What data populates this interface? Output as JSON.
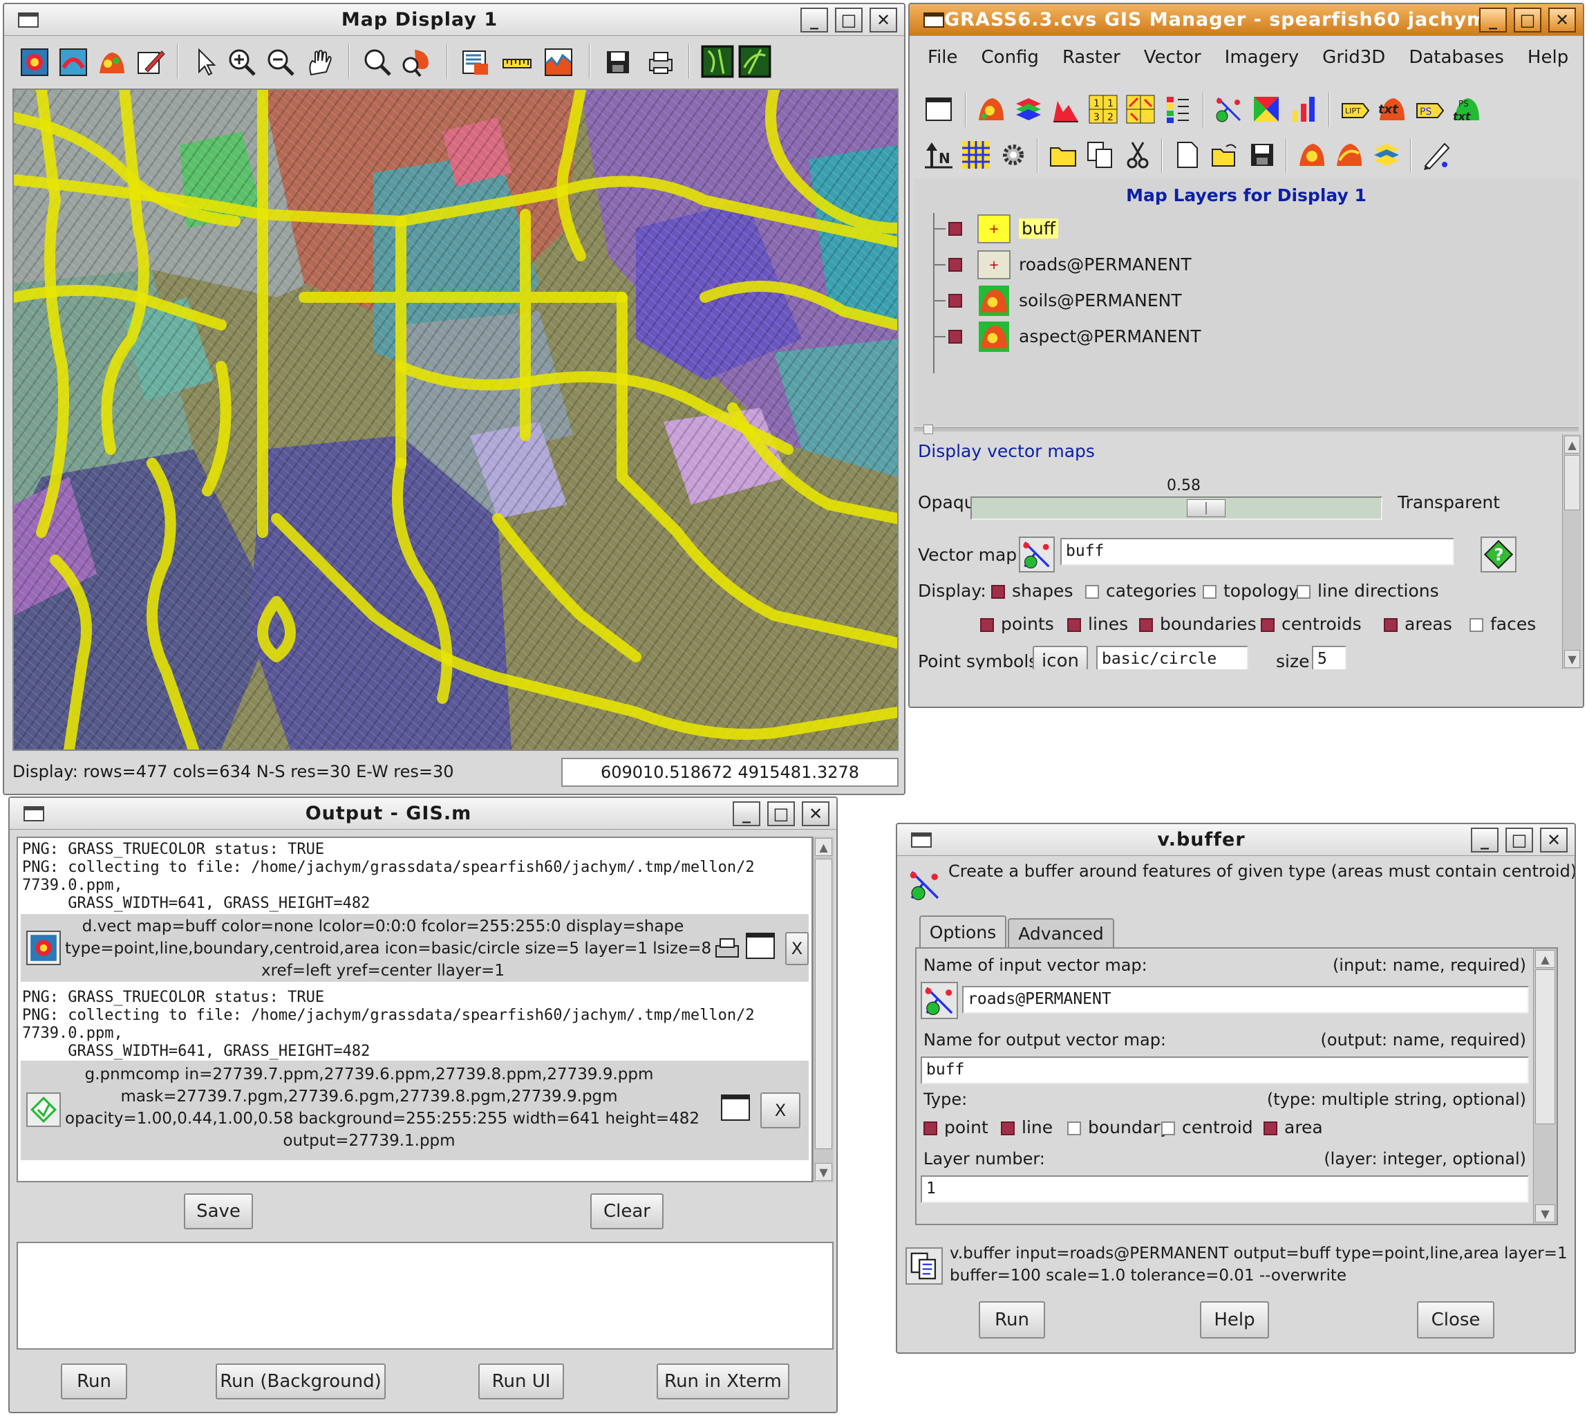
{
  "map_display": {
    "title": "Map Display 1",
    "status_left": "Display: rows=477 cols=634 N-S res=30 E-W res=30",
    "status_right": "609010.518672 4915481.3278",
    "toolbar_icons": [
      "display-map-icon",
      "redraw-icon",
      "add-overlay-icon",
      "erase-icon",
      "pointer-icon",
      "zoom-in-icon",
      "zoom-out-icon",
      "pan-icon",
      "zoom-extent-icon",
      "zoom-region-icon",
      "query-icon",
      "measure-icon",
      "profile-icon",
      "save-display-icon",
      "print-icon",
      "nviz-icon",
      "georectify-icon"
    ]
  },
  "gis_manager": {
    "title": "GRASS6.3.cvs GIS Manager - spearfish60 jachym",
    "menu": [
      "File",
      "Config",
      "Raster",
      "Vector",
      "Imagery",
      "Grid3D",
      "Databases",
      "Help"
    ],
    "layers_header": "Map Layers for Display 1",
    "layers": [
      {
        "name": "buff",
        "icon": "vector-layer-icon",
        "highlight": true
      },
      {
        "name": "roads@PERMANENT",
        "icon": "vector-layer-icon",
        "highlight": false
      },
      {
        "name": "soils@PERMANENT",
        "icon": "raster-layer-icon",
        "highlight": false
      },
      {
        "name": "aspect@PERMANENT",
        "icon": "raster-layer-icon",
        "highlight": false
      }
    ],
    "panel": {
      "heading": "Display vector maps",
      "opacity_value": "0.58",
      "opacity_fraction": 0.58,
      "opaque_label": "Opaque",
      "transparent_label": "Transparent",
      "vector_map_label": "Vector map:",
      "vector_map_value": "buff",
      "display_label": "Display:",
      "display_options": [
        {
          "label": "shapes",
          "checked": true
        },
        {
          "label": "categories",
          "checked": false
        },
        {
          "label": "topology",
          "checked": false
        },
        {
          "label": "line directions",
          "checked": false
        }
      ],
      "type_options": [
        {
          "label": "points",
          "checked": true
        },
        {
          "label": "lines",
          "checked": true
        },
        {
          "label": "boundaries",
          "checked": true
        },
        {
          "label": "centroids",
          "checked": true
        },
        {
          "label": "areas",
          "checked": true
        },
        {
          "label": "faces",
          "checked": false
        }
      ],
      "point_symbols_label": "Point symbols:",
      "icon_button": "icon",
      "symbol_value": "basic/circle",
      "size_label": "size",
      "size_value": "5"
    }
  },
  "output": {
    "title": "Output - GIS.m",
    "log1": [
      "PNG: GRASS_TRUECOLOR status: TRUE",
      "PNG: collecting to file: /home/jachym/grassdata/spearfish60/jachym/.tmp/mellon/2",
      "7739.0.ppm,",
      "     GRASS_WIDTH=641, GRASS_HEIGHT=482"
    ],
    "cmd1": [
      "d.vect map=buff color=none lcolor=0:0:0 fcolor=255:255:0 display=shape",
      "type=point,line,boundary,centroid,area icon=basic/circle size=5 layer=1 lsize=8",
      "xref=left yref=center llayer=1"
    ],
    "log2": [
      "PNG: GRASS_TRUECOLOR status: TRUE",
      "PNG: collecting to file: /home/jachym/grassdata/spearfish60/jachym/.tmp/mellon/2",
      "7739.0.ppm,",
      "     GRASS_WIDTH=641, GRASS_HEIGHT=482"
    ],
    "cmd2": [
      "g.pnmcomp in=27739.7.ppm,27739.6.ppm,27739.8.ppm,27739.9.ppm",
      "mask=27739.7.pgm,27739.6.pgm,27739.8.pgm,27739.9.pgm",
      "opacity=1.00,0.44,1.00,0.58 background=255:255:255 width=641 height=482",
      "output=27739.1.ppm"
    ],
    "close_label": "X",
    "save": "Save",
    "clear": "Clear",
    "run": "Run",
    "run_background": "Run (Background)",
    "run_ui": "Run UI",
    "run_xterm": "Run in Xterm"
  },
  "vbuffer": {
    "title": "v.buffer",
    "description": "Create a buffer around features of given type (areas must contain centroid).",
    "tabs": [
      "Options",
      "Advanced"
    ],
    "input_label": "Name of input vector map:",
    "input_hint": "(input:  name, required)",
    "input_value": "roads@PERMANENT",
    "output_label": "Name for output vector map:",
    "output_hint": "(output:  name, required)",
    "output_value": "buff",
    "type_label": "Type:",
    "type_hint": "(type: multiple string, optional)",
    "types": [
      {
        "label": "point",
        "checked": true
      },
      {
        "label": "line",
        "checked": true
      },
      {
        "label": "boundary",
        "checked": false
      },
      {
        "label": "centroid",
        "checked": false
      },
      {
        "label": "area",
        "checked": true
      }
    ],
    "layer_label": "Layer number:",
    "layer_hint": "(layer:  integer, optional)",
    "layer_value": "1",
    "command": [
      "v.buffer input=roads@PERMANENT output=buff type=point,line,area layer=1",
      "buffer=100 scale=1.0 tolerance=0.01 --overwrite"
    ],
    "run": "Run",
    "help": "Help",
    "close": "Close"
  },
  "colors": {
    "buffer_yellow": "#e8e600",
    "checkbox_on": "#a0304a",
    "header_blue": "#0a1fa8",
    "title_orange": "#e0891f"
  }
}
